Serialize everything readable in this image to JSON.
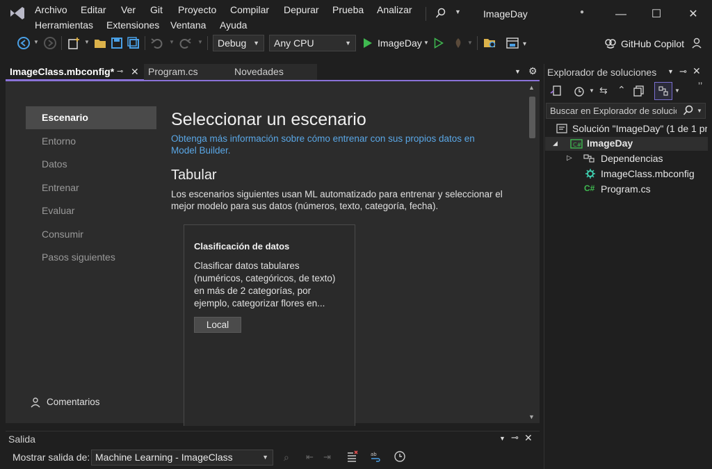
{
  "app": {
    "window_title": "ImageDay"
  },
  "menu": {
    "row1": [
      "Archivo",
      "Editar",
      "Ver",
      "Git",
      "Proyecto",
      "Compilar",
      "Depurar",
      "Prueba",
      "Analizar"
    ],
    "row2": [
      "Herramientas",
      "Extensiones",
      "Ventana",
      "Ayuda"
    ]
  },
  "toolbar": {
    "config": "Debug",
    "platform": "Any CPU",
    "run_target": "ImageDay",
    "copilot": "GitHub Copilot"
  },
  "tabs": [
    {
      "label": "ImageClass.mbconfig*",
      "active": true
    },
    {
      "label": "Program.cs",
      "active": false
    },
    {
      "label": "Novedades",
      "active": false
    }
  ],
  "sidebar": {
    "items": [
      "Escenario",
      "Entorno",
      "Datos",
      "Entrenar",
      "Evaluar",
      "Consumir",
      "Pasos siguientes"
    ],
    "feedback": "Comentarios"
  },
  "main": {
    "title": "Seleccionar un escenario",
    "link_line1": "Obtenga más información sobre cómo entrenar con sus propios datos en",
    "link_line2": "Model Builder.",
    "section_heading": "Tabular",
    "section_desc_line1": "Los escenarios siguientes usan ML automatizado para entrenar y seleccionar el",
    "section_desc_line2": "mejor modelo para sus datos (números, texto, categoría, fecha).",
    "card": {
      "title": "Clasificación de datos",
      "desc_lines": [
        "Clasificar datos tabulares",
        "(numéricos, categóricos, de texto)",
        "en más de 2 categorías, por",
        "ejemplo, categorizar flores en..."
      ],
      "button": "Local"
    }
  },
  "solution_explorer": {
    "title": "Explorador de soluciones",
    "search_placeholder": "Buscar en Explorador de soluciones",
    "solution": "Solución \"ImageDay\"  (1 de 1 pr",
    "project": "ImageDay",
    "items": [
      "Dependencias",
      "ImageClass.mbconfig",
      "Program.cs"
    ]
  },
  "output": {
    "title": "Salida",
    "show_label": "Mostrar salida de:",
    "source": "Machine Learning - ImageClass"
  },
  "colors": {
    "accent": "#8a72d8",
    "link": "#5aa7e6",
    "run_green": "#3fb950",
    "background": "#1f1f1f",
    "panel": "#2c2c2c"
  }
}
